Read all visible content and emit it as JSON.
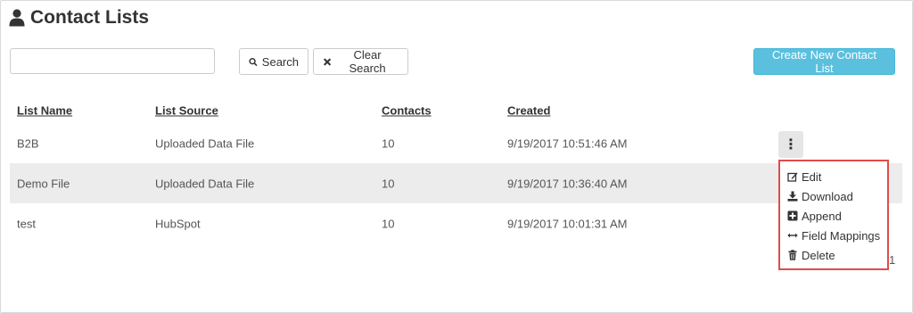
{
  "page": {
    "title": "Contact Lists",
    "icon": "user-icon"
  },
  "search": {
    "placeholder": "",
    "value": "",
    "search_label": "Search",
    "clear_label": "Clear Search"
  },
  "actions": {
    "create_label": "Create New Contact List",
    "create_color": "#5bc0de"
  },
  "table": {
    "headers": [
      "List Name",
      "List Source",
      "Contacts",
      "Created"
    ],
    "rows": [
      {
        "name": "B2B",
        "source": "Uploaded Data File",
        "contacts": "10",
        "created": "9/19/2017 10:51:46 AM"
      },
      {
        "name": "Demo File",
        "source": "Uploaded Data File",
        "contacts": "10",
        "created": "9/19/2017 10:36:40 AM"
      },
      {
        "name": "test",
        "source": "HubSpot",
        "contacts": "10",
        "created": "9/19/2017 10:01:31 AM"
      }
    ],
    "row_menu_icon": "kebab-vertical-icon"
  },
  "row_menu": {
    "highlight_color": "#e14b4b",
    "items": [
      {
        "label": "Edit",
        "icon": "edit-icon"
      },
      {
        "label": "Download",
        "icon": "download-icon"
      },
      {
        "label": "Append",
        "icon": "plus-square-icon"
      },
      {
        "label": "Field Mappings",
        "icon": "arrows-horizontal-icon"
      },
      {
        "label": "Delete",
        "icon": "trash-icon"
      }
    ]
  },
  "pagination": {
    "current_page": "1"
  }
}
